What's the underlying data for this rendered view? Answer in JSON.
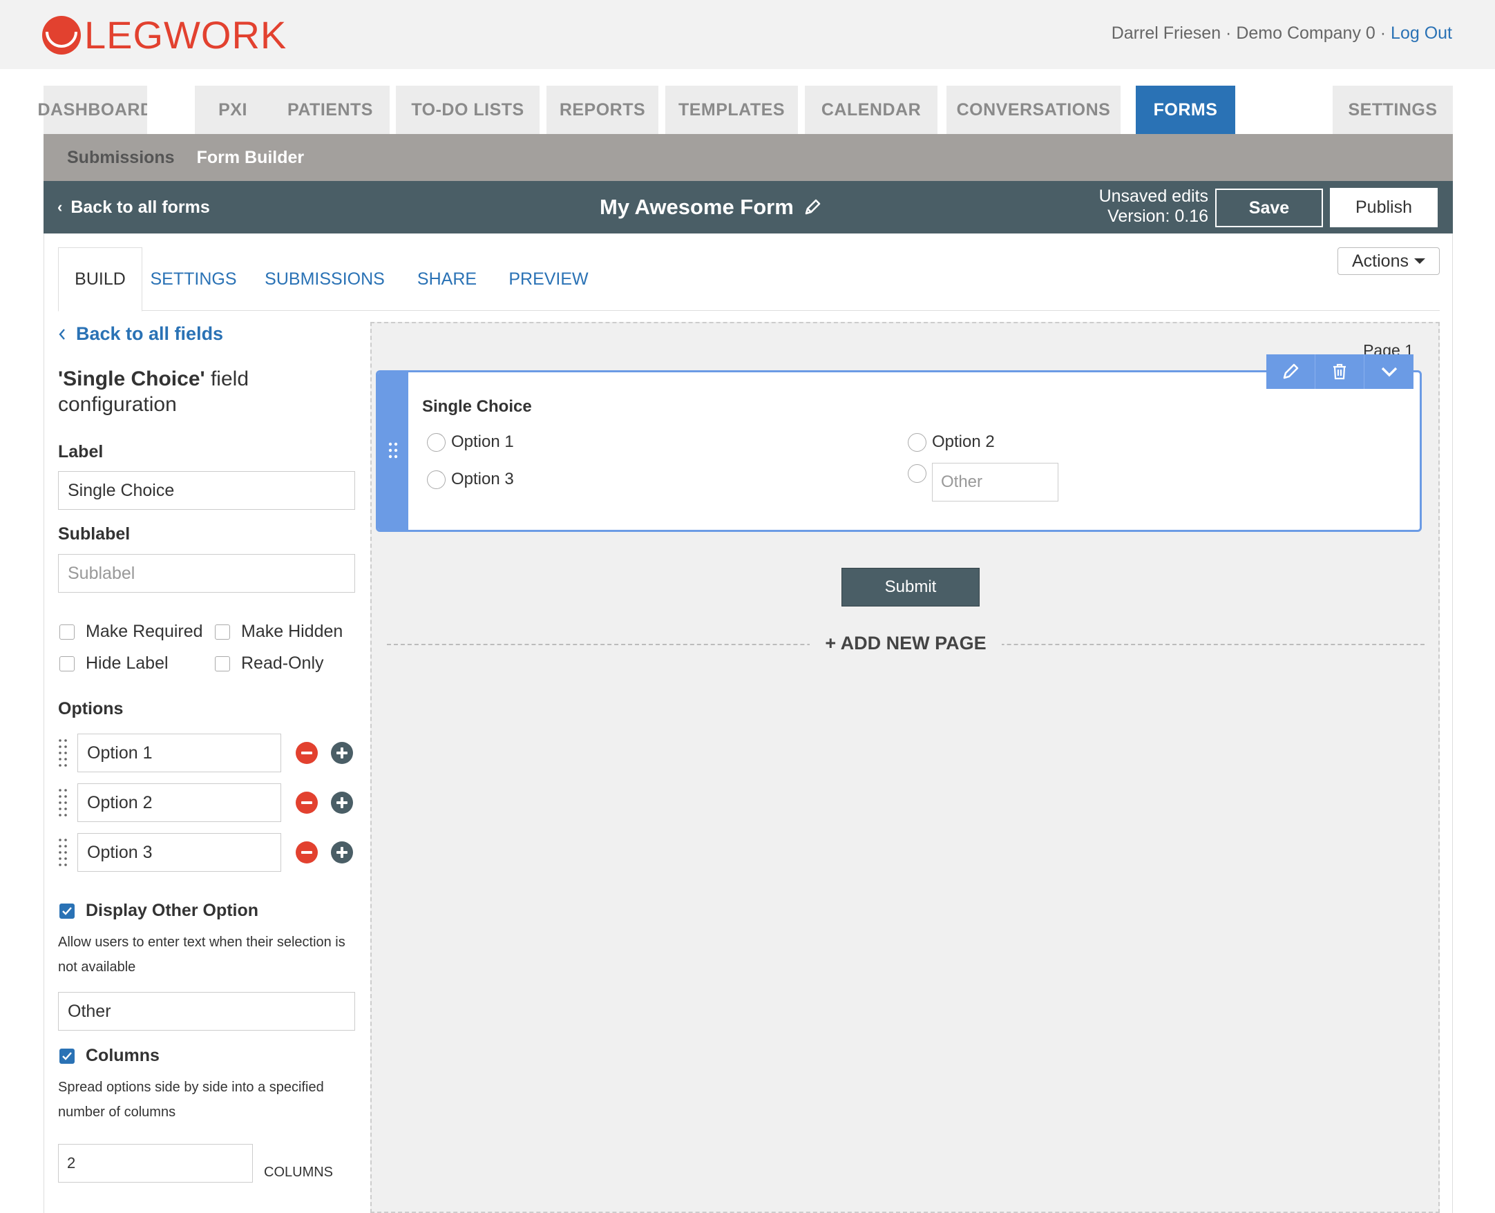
{
  "brand": {
    "name": "LEGWORK",
    "color": "#e2412f"
  },
  "user": {
    "name": "Darrel Friesen",
    "company": "Demo Company 0",
    "logout": "Log Out",
    "separator": "·"
  },
  "nav": {
    "tabs": [
      "DASHBOARD",
      "PXI",
      "PATIENTS",
      "TO-DO LISTS",
      "REPORTS",
      "TEMPLATES",
      "CALENDAR",
      "CONVERSATIONS",
      "FORMS",
      "SETTINGS"
    ],
    "active": "FORMS"
  },
  "subnav": {
    "items": [
      "Submissions",
      "Form Builder"
    ],
    "active": "Form Builder"
  },
  "formbar": {
    "back": "Back to all forms",
    "title": "My Awesome Form",
    "status": "Unsaved edits",
    "version": "Version: 0.16",
    "save": "Save",
    "publish": "Publish"
  },
  "tabs": {
    "items": [
      "BUILD",
      "SETTINGS",
      "SUBMISSIONS",
      "SHARE",
      "PREVIEW"
    ],
    "active": "BUILD",
    "actions": "Actions"
  },
  "config": {
    "back": "Back to all fields",
    "title_field": "'Single Choice'",
    "title_rest": " field configuration",
    "label_title": "Label",
    "label_value": "Single Choice",
    "sublabel_title": "Sublabel",
    "sublabel_placeholder": "Sublabel",
    "checkboxes": {
      "required": "Make Required",
      "hidden": "Make Hidden",
      "hide_label": "Hide Label",
      "read_only": "Read-Only"
    },
    "options_title": "Options",
    "options": [
      "Option 1",
      "Option 2",
      "Option 3"
    ],
    "other": {
      "title": "Display Other Option",
      "checked": true,
      "help": "Allow users to enter text when their selection is not available",
      "value": "Other"
    },
    "columns": {
      "title": "Columns",
      "checked": true,
      "help": "Spread options side by side into a specified number of columns",
      "value": "2",
      "unit": "COLUMNS"
    }
  },
  "canvas": {
    "page_label": "Page 1",
    "field_label": "Single Choice",
    "options": [
      "Option 1",
      "Option 2",
      "Option 3"
    ],
    "other_placeholder": "Other",
    "submit": "Submit",
    "add_page": "+ ADD NEW PAGE"
  }
}
